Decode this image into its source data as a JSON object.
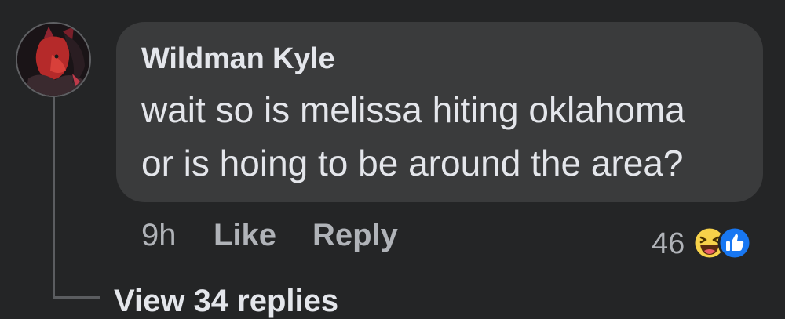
{
  "comment": {
    "author": "Wildman Kyle",
    "text_line_1": "wait so is melissa hiting oklahoma",
    "text_line_2": "or is hoing to be around the area?",
    "time": "9h",
    "like_label": "Like",
    "reply_label": "Reply",
    "reaction_count": "46",
    "reactions": [
      "haha-icon",
      "like-icon"
    ]
  },
  "thread": {
    "view_replies_label": "View 34 replies"
  },
  "colors": {
    "background": "#242526",
    "bubble": "#3a3b3c",
    "primary_text": "#e4e6eb",
    "secondary_text": "#b0b3b8",
    "like_blue": "#1877f2",
    "haha_yellow": "#f7d24a"
  }
}
